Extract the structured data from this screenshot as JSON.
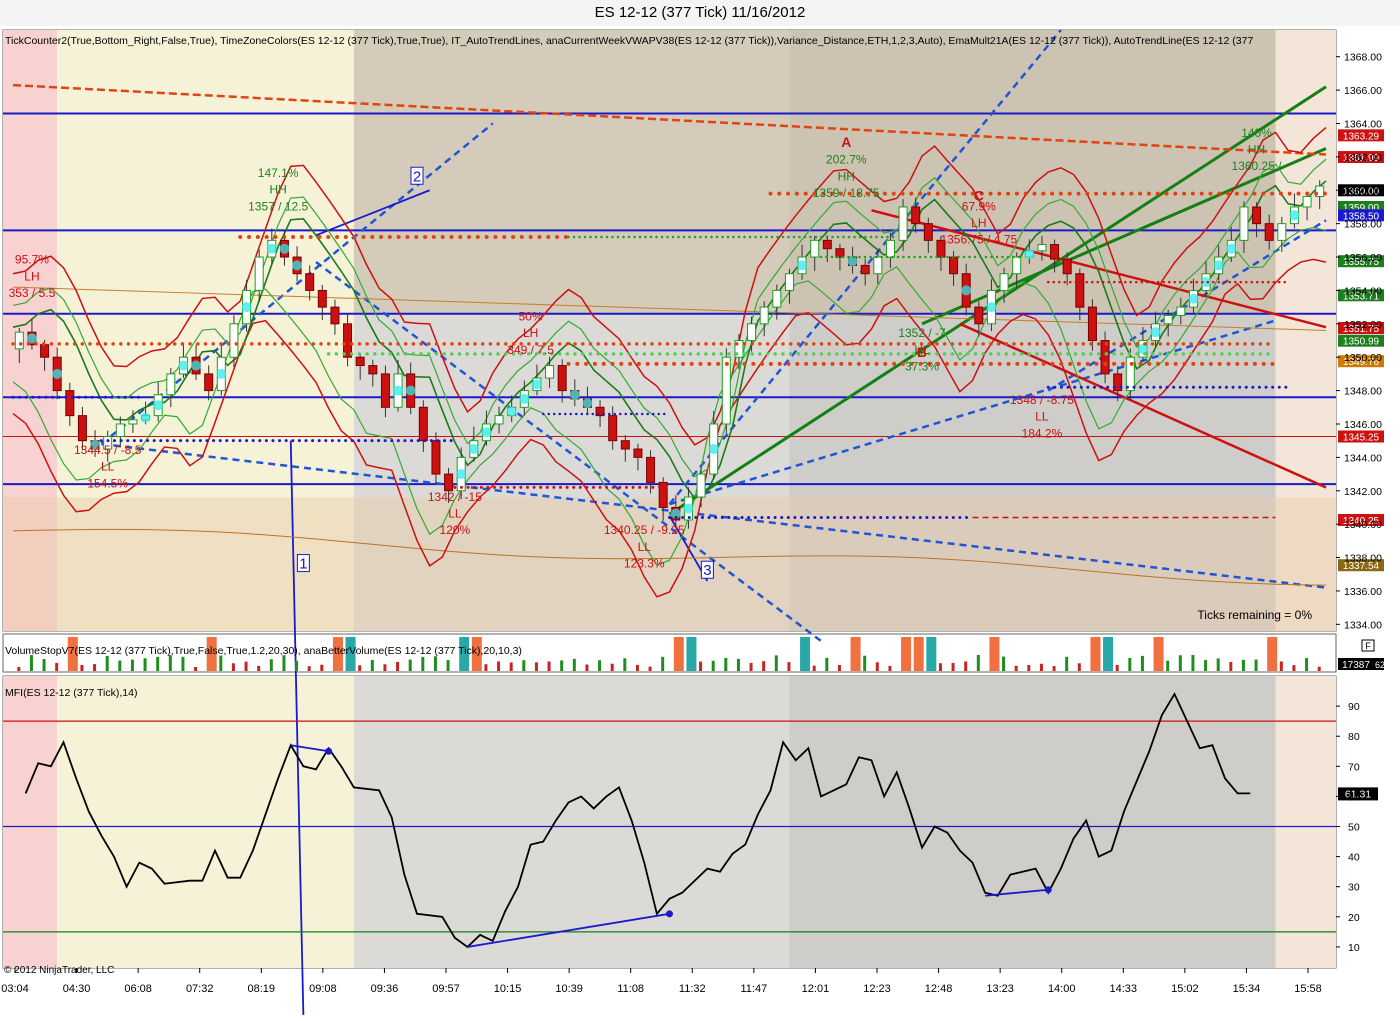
{
  "title": "ES 12-12 (377 Tick)  11/16/2012",
  "indicator_labels": {
    "price": "TickCounter2(True,Bottom_Right,False,True), TimeZoneColors(ES 12-12 (377 Tick),True,True), IT_AutoTrendLines, anaCurrentWeekVWAPV38(ES 12-12 (377 Tick)),Variance_Distance,ETH,1,2,3,Auto), EmaMult21A(ES 12-12 (377 Tick)), AutoTrendLine(ES 12-12 (377",
    "volume": "VolumeStopV7(ES 12-12 (377 Tick),True,False,True,1.2,20,30), anaBetterVolume(ES 12-12 (377 Tick),20,10,3)",
    "mfi": "MFI(ES 12-12 (377 Tick),14)"
  },
  "ticks_remaining": "Ticks remaining = 0%",
  "copyright": "© 2012 NinjaTrader, LLC",
  "colors": {
    "up": "#1e9e1e",
    "down": "#cc1111",
    "trend_blue": "#1f55d6",
    "hline_blue": "#1a1acc",
    "green_line": "#128012",
    "vwap_orange": "#e0440f",
    "mfi_line": "#000000"
  },
  "chart_data": [
    {
      "type": "candlestick",
      "title": "ES 12-12 (377 Tick)  11/16/2012",
      "ylim": [
        1333.6,
        1369.6
      ],
      "y_ticks": [
        1334.0,
        1336.0,
        1338.0,
        1340.0,
        1342.0,
        1344.0,
        1346.0,
        1348.0,
        1350.0,
        1352.0,
        1354.0,
        1356.0,
        1358.0,
        1360.0,
        1362.0,
        1364.0,
        1366.0,
        1368.0
      ],
      "x_tick_labels": [
        "03:04",
        "04:30",
        "06:08",
        "07:32",
        "08:19",
        "09:08",
        "09:36",
        "09:57",
        "10:15",
        "10:39",
        "11:08",
        "11:32",
        "11:47",
        "12:01",
        "12:23",
        "12:48",
        "13:23",
        "14:00",
        "14:33",
        "15:02",
        "15:34",
        "15:58"
      ],
      "price_path": [
        [
          0,
          1350.5
        ],
        [
          1,
          1351.5
        ],
        [
          3,
          1350
        ],
        [
          4,
          1348
        ],
        [
          6,
          1345
        ],
        [
          7,
          1344.5
        ],
        [
          9,
          1346
        ],
        [
          11,
          1346.5
        ],
        [
          13,
          1349
        ],
        [
          14,
          1350
        ],
        [
          16,
          1348
        ],
        [
          17,
          1350
        ],
        [
          19,
          1354
        ],
        [
          20,
          1356
        ],
        [
          21,
          1357
        ],
        [
          23,
          1355
        ],
        [
          25,
          1353
        ],
        [
          26,
          1352
        ],
        [
          27,
          1350
        ],
        [
          29,
          1349
        ],
        [
          30,
          1347
        ],
        [
          31,
          1349
        ],
        [
          32,
          1347
        ],
        [
          33,
          1345
        ],
        [
          34,
          1343
        ],
        [
          35,
          1342
        ],
        [
          36,
          1344
        ],
        [
          38,
          1346
        ],
        [
          40,
          1347
        ],
        [
          41,
          1348
        ],
        [
          43,
          1349.5
        ],
        [
          44,
          1348
        ],
        [
          46,
          1347
        ],
        [
          47,
          1346.5
        ],
        [
          48,
          1345
        ],
        [
          50,
          1344
        ],
        [
          52,
          1341
        ],
        [
          53,
          1340.25
        ],
        [
          55,
          1343
        ],
        [
          56,
          1346
        ],
        [
          57,
          1350
        ],
        [
          59,
          1352
        ],
        [
          61,
          1354
        ],
        [
          63,
          1356
        ],
        [
          64,
          1357
        ],
        [
          66,
          1356
        ],
        [
          68,
          1355
        ],
        [
          70,
          1357
        ],
        [
          71,
          1359
        ],
        [
          72,
          1358
        ],
        [
          74,
          1356
        ],
        [
          75,
          1355
        ],
        [
          76,
          1353
        ],
        [
          77,
          1352
        ],
        [
          78,
          1354
        ],
        [
          80,
          1356
        ],
        [
          82,
          1356.75
        ],
        [
          84,
          1355
        ],
        [
          85,
          1353
        ],
        [
          86,
          1351
        ],
        [
          87,
          1349
        ],
        [
          88,
          1348
        ],
        [
          89,
          1350
        ],
        [
          91,
          1352
        ],
        [
          93,
          1353
        ],
        [
          95,
          1355
        ],
        [
          97,
          1357
        ],
        [
          98,
          1359
        ],
        [
          100,
          1357
        ],
        [
          101,
          1358
        ],
        [
          102,
          1359
        ],
        [
          104,
          1360.25
        ]
      ],
      "x_count": 104,
      "horizontal_levels": [
        {
          "price": 1364.6,
          "color": "#1a1acc"
        },
        {
          "price": 1357.6,
          "color": "#1a1acc"
        },
        {
          "price": 1352.6,
          "color": "#1a1acc"
        },
        {
          "price": 1347.6,
          "color": "#1a1acc"
        },
        {
          "price": 1342.4,
          "color": "#1a1acc"
        },
        {
          "price": 1345.25,
          "color": "#cc1111"
        }
      ],
      "annotations": [
        {
          "text": "95.7%",
          "x": 1.5,
          "y": 1355.6,
          "color": "#cc1111"
        },
        {
          "text": "LH",
          "x": 1.5,
          "y": 1354.6,
          "color": "#cc1111"
        },
        {
          "text": "353 / 5.5",
          "x": 1.5,
          "y": 1353.6,
          "color": "#cc1111"
        },
        {
          "text": "1344.5 / -8.5",
          "x": 7.5,
          "y": 1344.2,
          "color": "#cc1111"
        },
        {
          "text": "LL",
          "x": 7.5,
          "y": 1343.2,
          "color": "#cc1111"
        },
        {
          "text": "154.5%",
          "x": 7.5,
          "y": 1342.2,
          "color": "#cc1111"
        },
        {
          "text": "147.1%",
          "x": 21,
          "y": 1360.8,
          "color": "#1e7e1e"
        },
        {
          "text": "HH",
          "x": 21,
          "y": 1359.8,
          "color": "#1e7e1e"
        },
        {
          "text": "1357 / 12.5",
          "x": 21,
          "y": 1358.8,
          "color": "#1e7e1e"
        },
        {
          "text": "1342 / -15",
          "x": 35,
          "y": 1341.4,
          "color": "#cc1111"
        },
        {
          "text": "LL",
          "x": 35,
          "y": 1340.4,
          "color": "#cc1111"
        },
        {
          "text": "120%",
          "x": 35,
          "y": 1339.4,
          "color": "#cc1111"
        },
        {
          "text": "50%",
          "x": 41,
          "y": 1352.2,
          "color": "#cc1111"
        },
        {
          "text": "LH",
          "x": 41,
          "y": 1351.2,
          "color": "#cc1111"
        },
        {
          "text": "349 / 7.5",
          "x": 41,
          "y": 1350.2,
          "color": "#cc1111"
        },
        {
          "text": "1340.25 / -9.25",
          "x": 50,
          "y": 1339.4,
          "color": "#cc1111"
        },
        {
          "text": "LL",
          "x": 50,
          "y": 1338.4,
          "color": "#cc1111"
        },
        {
          "text": "123.3%",
          "x": 50,
          "y": 1337.4,
          "color": "#cc1111"
        },
        {
          "text": "A",
          "x": 66,
          "y": 1362.6,
          "color": "#cc1111"
        },
        {
          "text": "202.7%",
          "x": 66,
          "y": 1361.6,
          "color": "#1e7e1e"
        },
        {
          "text": "HH",
          "x": 66,
          "y": 1360.6,
          "color": "#1e7e1e"
        },
        {
          "text": "1359 / 18.75",
          "x": 66,
          "y": 1359.6,
          "color": "#1e7e1e"
        },
        {
          "text": "C",
          "x": 76.5,
          "y": 1359.4,
          "color": "#cc1111"
        },
        {
          "text": "67.9%",
          "x": 76.5,
          "y": 1358.8,
          "color": "#cc1111"
        },
        {
          "text": "LH",
          "x": 76.5,
          "y": 1357.8,
          "color": "#cc1111"
        },
        {
          "text": "1356.75 / 4.75",
          "x": 76.5,
          "y": 1356.8,
          "color": "#cc1111"
        },
        {
          "text": "1352 / -7",
          "x": 72,
          "y": 1351.2,
          "color": "#1e7e1e"
        },
        {
          "text": "HL",
          "x": 72,
          "y": 1350.2,
          "color": "#1e7e1e"
        },
        {
          "text": "37.3%",
          "x": 72,
          "y": 1349.2,
          "color": "#1e7e1e"
        },
        {
          "text": "B",
          "x": 72,
          "y": 1350.0,
          "color": "#cc1111"
        },
        {
          "text": "1348 / -8.75",
          "x": 81.5,
          "y": 1347.2,
          "color": "#cc1111"
        },
        {
          "text": "LL",
          "x": 81.5,
          "y": 1346.2,
          "color": "#cc1111"
        },
        {
          "text": "184.2%",
          "x": 81.5,
          "y": 1345.2,
          "color": "#cc1111"
        },
        {
          "text": "140%",
          "x": 98.5,
          "y": 1363.2,
          "color": "#1e7e1e"
        },
        {
          "text": "HH",
          "x": 98.5,
          "y": 1362.2,
          "color": "#1e7e1e"
        },
        {
          "text": "1360.25 /",
          "x": 98.5,
          "y": 1361.2,
          "color": "#1e7e1e"
        }
      ],
      "callouts": [
        "1",
        "2",
        "3"
      ],
      "price_tags": [
        {
          "value": "1363.29",
          "color": "#cc1111"
        },
        {
          "value": "1361.99",
          "color": "#cc1111"
        },
        {
          "value": "1360.00",
          "color": "#000000"
        },
        {
          "value": "1359.00",
          "color": "#1e7e1e"
        },
        {
          "value": "1358.50",
          "color": "#1a1acc"
        },
        {
          "value": "1355.75",
          "color": "#1e7e1e"
        },
        {
          "value": "1353.71",
          "color": "#1e7e1e"
        },
        {
          "value": "1351.75",
          "color": "#cc1111"
        },
        {
          "value": "1350.99",
          "color": "#1e7e1e"
        },
        {
          "value": "1349.76",
          "color": "#cc7a00"
        },
        {
          "value": "1345.25",
          "color": "#cc1111"
        },
        {
          "value": "1340.25",
          "color": "#cc1111"
        },
        {
          "value": "1337.54",
          "color": "#8b6914"
        }
      ]
    },
    {
      "type": "bar",
      "title": "VolumeStopV7(ES 12-12 (377 Tick),True,False,True,1.2,20,30), anaBetterVolume(ES 12-12 (377 Tick),20,10,3)",
      "last_value": "17387",
      "last_value_suffix": "62",
      "marker": "F"
    },
    {
      "type": "line",
      "title": "MFI(ES 12-12 (377 Tick),14)",
      "ylim": [
        3,
        100
      ],
      "y_ticks": [
        10,
        20,
        30,
        40,
        50,
        60,
        70,
        80,
        90
      ],
      "levels": [
        {
          "value": 85,
          "color": "#cc1111"
        },
        {
          "value": 50,
          "color": "#1a1acc"
        },
        {
          "value": 15,
          "color": "#128012"
        }
      ],
      "last_value": "61.31",
      "values": [
        [
          1,
          61
        ],
        [
          2,
          71
        ],
        [
          3,
          70
        ],
        [
          4,
          78
        ],
        [
          5,
          66
        ],
        [
          6,
          55
        ],
        [
          7,
          47
        ],
        [
          8,
          40
        ],
        [
          9,
          30
        ],
        [
          10,
          38
        ],
        [
          11,
          36
        ],
        [
          12,
          31
        ],
        [
          14,
          32
        ],
        [
          15,
          32
        ],
        [
          16,
          42
        ],
        [
          17,
          33
        ],
        [
          18,
          33
        ],
        [
          19,
          42
        ],
        [
          20,
          54
        ],
        [
          21,
          66
        ],
        [
          22,
          77
        ],
        [
          23,
          70
        ],
        [
          24,
          69
        ],
        [
          25,
          76
        ],
        [
          26,
          70
        ],
        [
          27,
          63
        ],
        [
          29,
          62
        ],
        [
          30,
          53
        ],
        [
          31,
          34
        ],
        [
          32,
          21
        ],
        [
          34,
          20
        ],
        [
          35,
          13
        ],
        [
          36,
          10
        ],
        [
          37,
          14
        ],
        [
          38,
          12
        ],
        [
          39,
          22
        ],
        [
          40,
          30
        ],
        [
          41,
          44
        ],
        [
          42,
          45
        ],
        [
          43,
          52
        ],
        [
          44,
          58
        ],
        [
          45,
          60
        ],
        [
          46,
          56
        ],
        [
          47,
          60
        ],
        [
          48,
          63
        ],
        [
          49,
          52
        ],
        [
          50,
          38
        ],
        [
          51,
          21
        ],
        [
          52,
          26
        ],
        [
          53,
          28
        ],
        [
          55,
          36
        ],
        [
          56,
          35
        ],
        [
          57,
          41
        ],
        [
          58,
          44
        ],
        [
          59,
          54
        ],
        [
          60,
          62
        ],
        [
          61,
          78
        ],
        [
          62,
          72
        ],
        [
          63,
          76
        ],
        [
          64,
          60
        ],
        [
          66,
          64
        ],
        [
          67,
          73
        ],
        [
          68,
          72
        ],
        [
          69,
          60
        ],
        [
          70,
          68
        ],
        [
          71,
          56
        ],
        [
          72,
          43
        ],
        [
          73,
          50
        ],
        [
          74,
          48
        ],
        [
          75,
          42
        ],
        [
          76,
          38
        ],
        [
          77,
          28
        ],
        [
          78,
          27
        ],
        [
          79,
          34
        ],
        [
          80,
          35
        ],
        [
          81,
          36
        ],
        [
          82,
          28
        ],
        [
          83,
          36
        ],
        [
          84,
          46
        ],
        [
          85,
          52
        ],
        [
          86,
          40
        ],
        [
          87,
          42
        ],
        [
          88,
          55
        ],
        [
          89,
          65
        ],
        [
          90,
          75
        ],
        [
          91,
          87
        ],
        [
          92,
          94
        ],
        [
          93,
          85
        ],
        [
          94,
          76
        ],
        [
          95,
          77
        ],
        [
          96,
          66
        ],
        [
          97,
          61
        ],
        [
          98,
          61
        ]
      ],
      "x_count": 104
    }
  ]
}
